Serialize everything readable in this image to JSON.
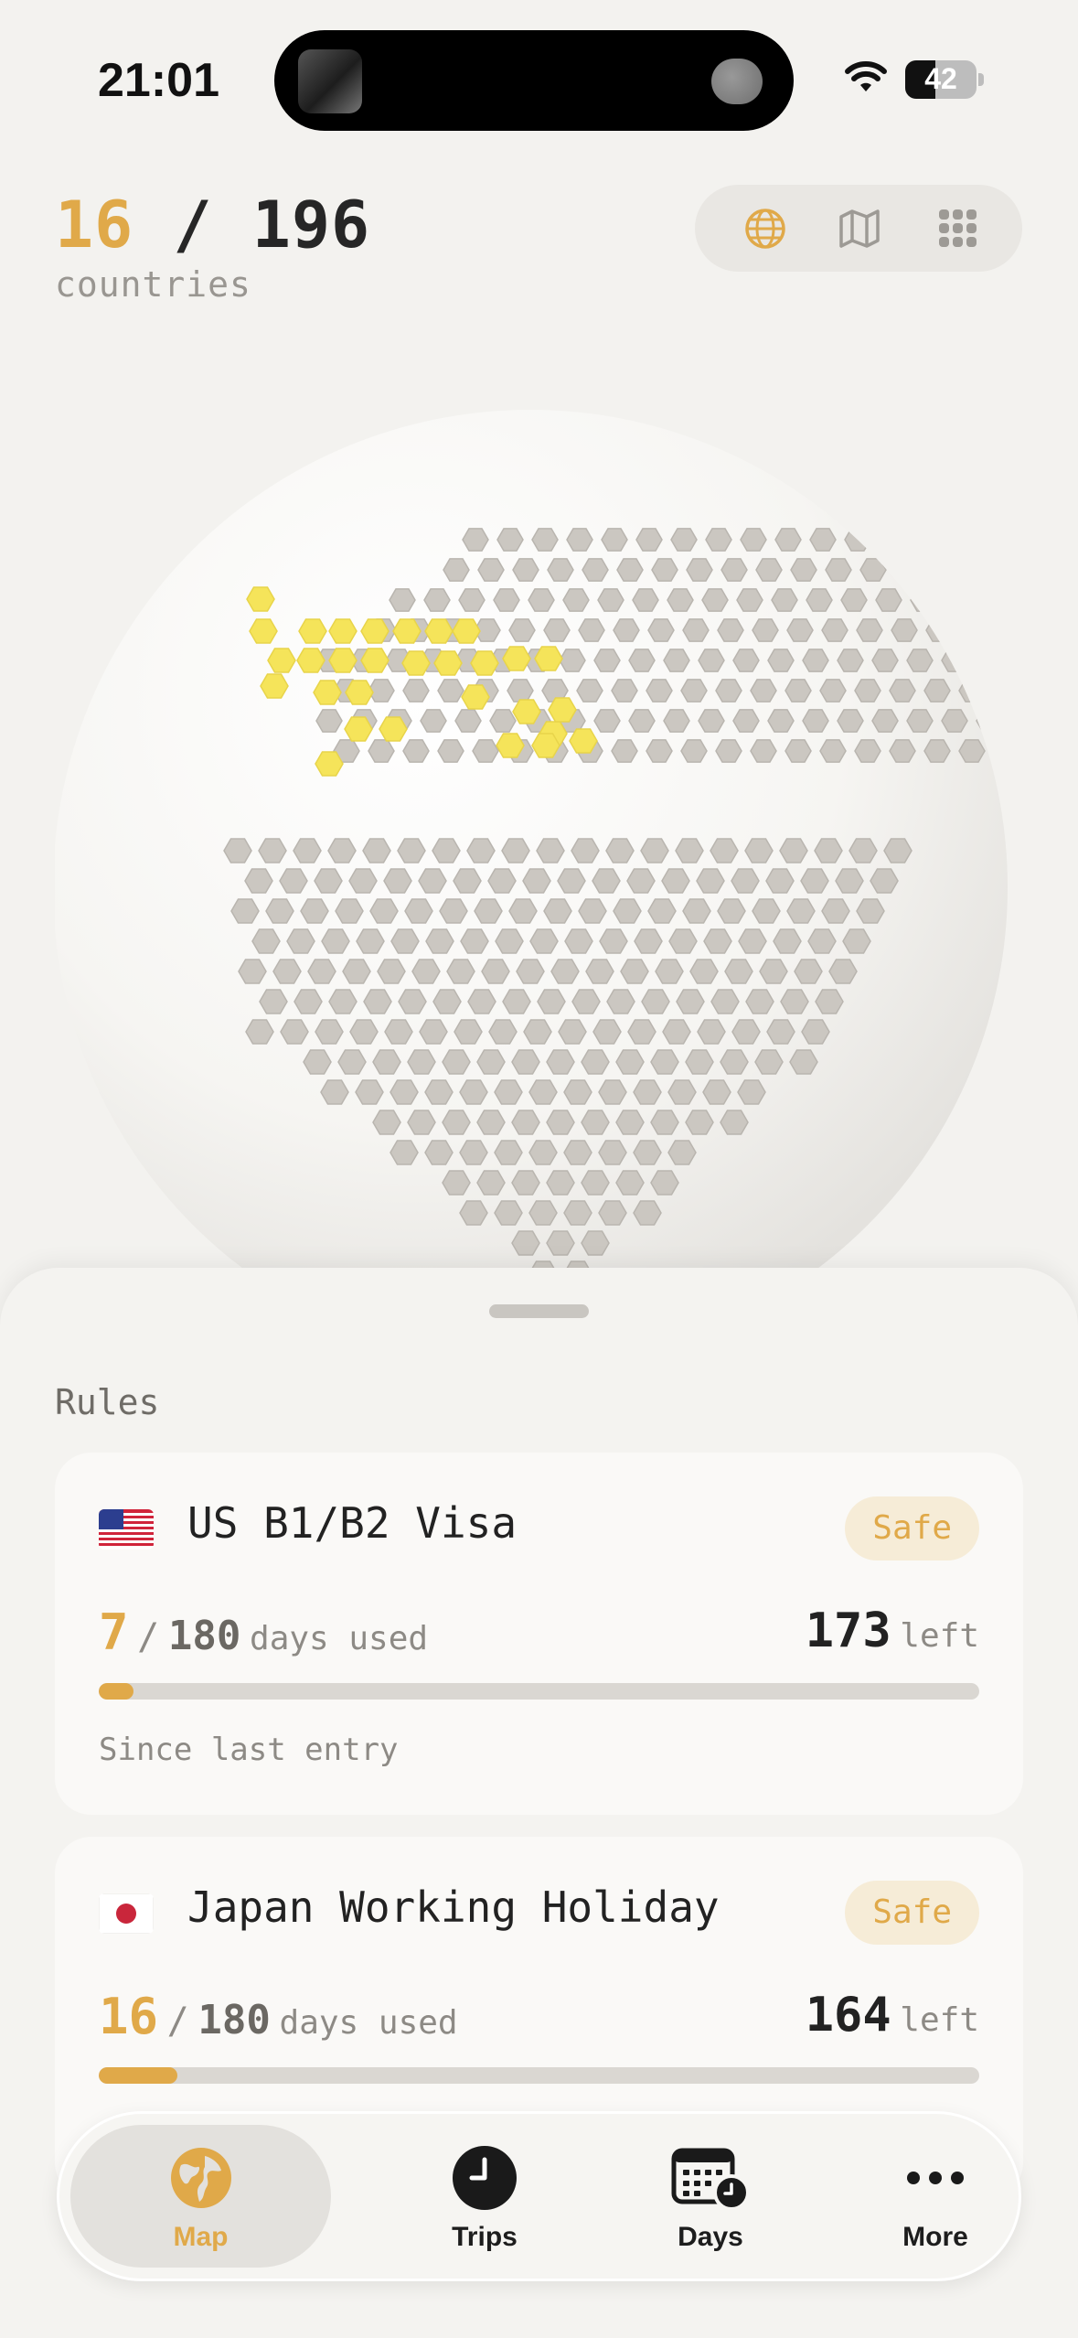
{
  "status_bar": {
    "time": "21:01",
    "battery": "42"
  },
  "header": {
    "visited": "16",
    "separator": "/",
    "total": "196",
    "caption": "countries",
    "views": [
      {
        "id": "globe",
        "icon": "globe-icon",
        "active": true
      },
      {
        "id": "map",
        "icon": "map-icon",
        "active": false
      },
      {
        "id": "grid",
        "icon": "grid-icon",
        "active": false
      }
    ]
  },
  "colors": {
    "accent": "#E0A949",
    "visited": "#F5E45A",
    "unvisited": "#CBC7C1",
    "background": "#F3F2EF"
  },
  "rules": {
    "title": "Rules",
    "items": [
      {
        "flag": "us-flag-icon",
        "name": "US B1/B2 Visa",
        "status": "Safe",
        "used": "7",
        "slash": "/",
        "limit": "180",
        "unit": "days used",
        "remaining": "173",
        "remaining_unit": "left",
        "progress": 0.039,
        "note": "Since last entry"
      },
      {
        "flag": "japan-flag-icon",
        "name": "Japan Working Holiday",
        "status": "Safe",
        "used": "16",
        "slash": "/",
        "limit": "180",
        "unit": "days used",
        "remaining": "164",
        "remaining_unit": "left",
        "progress": 0.089,
        "note": ""
      }
    ]
  },
  "tabs": [
    {
      "label": "Map",
      "icon": "globe-icon",
      "active": true
    },
    {
      "label": "Trips",
      "icon": "clock-icon",
      "active": false
    },
    {
      "label": "Days",
      "icon": "calendar-clock-icon",
      "active": false
    },
    {
      "label": "More",
      "icon": "more-icon",
      "active": false
    }
  ]
}
